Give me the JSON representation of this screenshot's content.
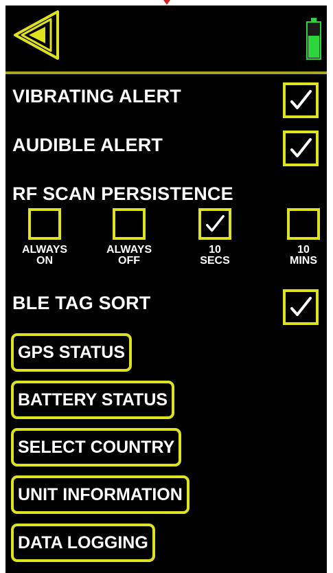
{
  "colors": {
    "accent": "#dfe21e",
    "background": "#000000",
    "text": "#ffffff",
    "battery_green": "#2bd53a",
    "divider": "#a7a520"
  },
  "header": {
    "back_icon": "back-arrow-icon",
    "battery_icon": "battery-icon"
  },
  "settings": {
    "vibrating_alert": {
      "label": "VIBRATING ALERT",
      "checked": true
    },
    "audible_alert": {
      "label": "AUDIBLE ALERT",
      "checked": true
    },
    "rf_scan_persistence": {
      "label": "RF SCAN PERSISTENCE",
      "options": [
        {
          "line1": "ALWAYS",
          "line2": "ON",
          "checked": false
        },
        {
          "line1": "ALWAYS",
          "line2": "OFF",
          "checked": false
        },
        {
          "line1": "10",
          "line2": "SECS",
          "checked": true
        },
        {
          "line1": "10",
          "line2": "MINS",
          "checked": false
        }
      ]
    },
    "ble_tag_sort": {
      "label": "BLE TAG SORT",
      "checked": true
    }
  },
  "menu": {
    "gps_status": "GPS STATUS",
    "battery_status": "BATTERY STATUS",
    "select_country": "SELECT COUNTRY",
    "unit_information": "UNIT INFORMATION",
    "data_logging": "DATA LOGGING"
  }
}
